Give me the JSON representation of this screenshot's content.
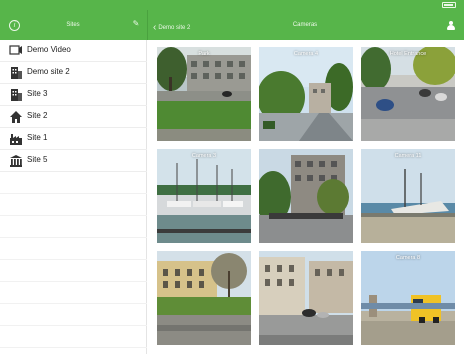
{
  "sidebar": {
    "title": "Sites",
    "items": [
      {
        "label": "Demo Video",
        "icon": "video-icon"
      },
      {
        "label": "Demo site 2",
        "icon": "office-building-icon"
      },
      {
        "label": "Site 3",
        "icon": "office-building-icon"
      },
      {
        "label": "Site 2",
        "icon": "house-icon"
      },
      {
        "label": "Site 1",
        "icon": "factory-icon"
      },
      {
        "label": "Site 5",
        "icon": "bank-building-icon"
      }
    ]
  },
  "header": {
    "back_label": "Demo site 2",
    "title": "Cameras"
  },
  "cameras": [
    {
      "caption": "Park"
    },
    {
      "caption": "Camera 4"
    },
    {
      "caption": "Hotel Entrance"
    },
    {
      "caption": "Camera 3"
    },
    {
      "caption": ""
    },
    {
      "caption": "Camera 11"
    },
    {
      "caption": ""
    },
    {
      "caption": ""
    },
    {
      "caption": "Camera 8"
    }
  ],
  "colors": {
    "accent": "#57b54a",
    "separator": "#ededed"
  }
}
